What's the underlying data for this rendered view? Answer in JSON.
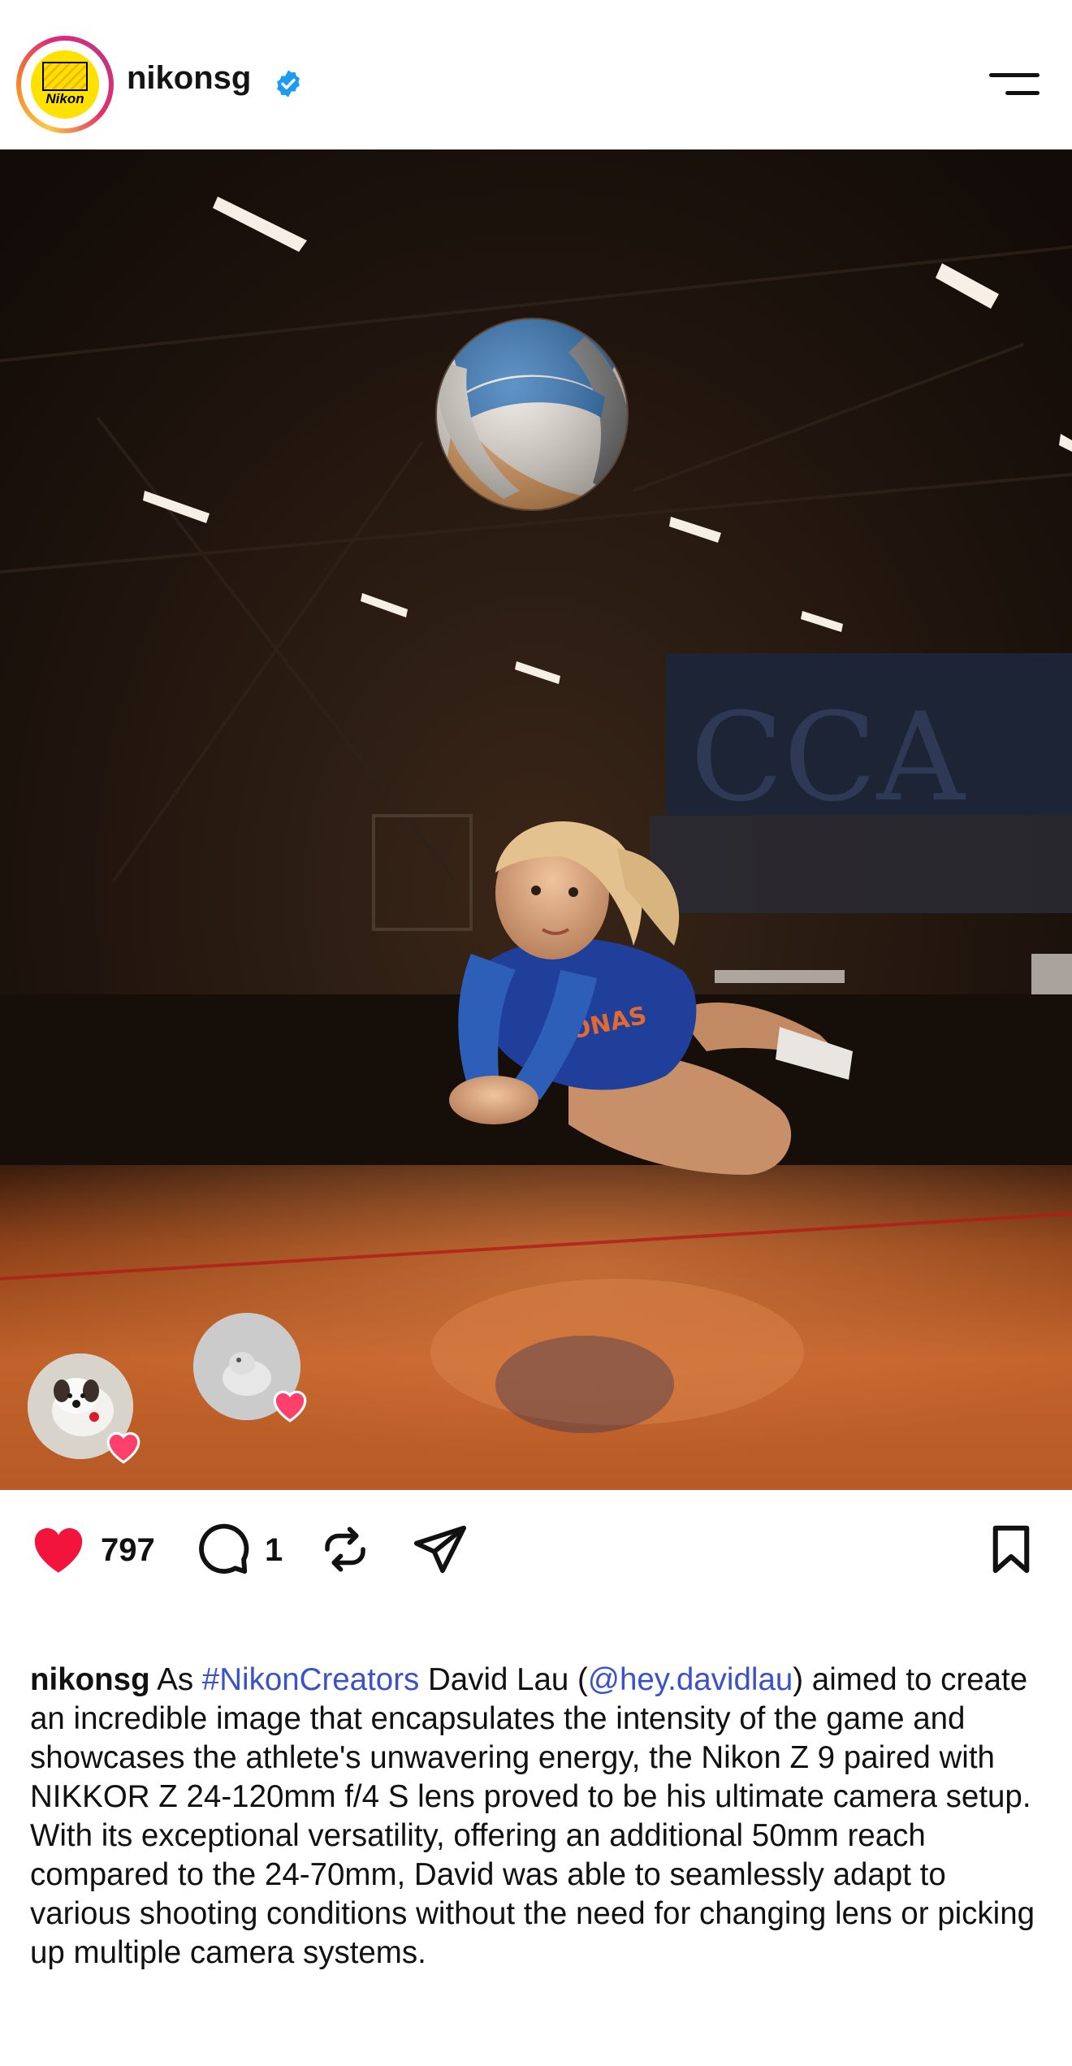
{
  "header": {
    "username": "nikonsg",
    "verified": true,
    "avatar_logo_text": "Nikon",
    "menu_icon": "menu-icon"
  },
  "post": {
    "photo_icon_names": [
      "volleyball",
      "player",
      "gym-lights"
    ],
    "liked_by_avatars": [
      "liker-avatar-dog",
      "liker-avatar-gray"
    ]
  },
  "actions": {
    "like_count": "797",
    "comment_count": "1",
    "icons": [
      "heart-icon",
      "comment-icon",
      "repost-icon",
      "share-icon",
      "bookmark-icon"
    ],
    "like_color": "#f2143b"
  },
  "caption": {
    "username": "nikonsg",
    "text_1": " As ",
    "hashtag": "#NikonCreators",
    "text_2": " David Lau (",
    "mention": "@hey.davidlau",
    "text_3": ") aimed to create an incredible image that encapsulates the intensity of the game and showcases the athlete's unwavering energy, the Nikon Z 9 paired with NIKKOR Z 24-120mm f/4 S lens proved to be his ultimate camera setup. With its exceptional versatility, offering an additional 50mm reach compared to the 24-70mm, David was able to seamlessly adapt to various shooting conditions without the need for changing lens or picking up multiple camera systems."
  },
  "colors": {
    "link": "#3b52c7",
    "verified_badge": "#1d9bf0",
    "heart": "#f2143b"
  }
}
